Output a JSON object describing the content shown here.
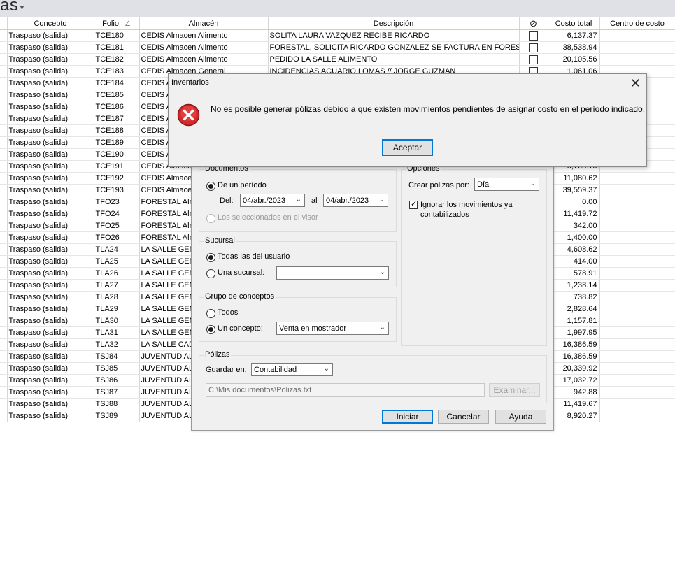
{
  "app": {
    "title_fragment": "as"
  },
  "grid": {
    "columns": [
      "",
      "Concepto",
      "Folio",
      "Almacén",
      "Descripción",
      "",
      "Costo total",
      "Centro de costo"
    ],
    "rows": [
      {
        "concepto": "Traspaso (salida)",
        "folio": "TCE180",
        "almacen": "CEDIS Almacen Alimento",
        "descripcion": "SOLITA LAURA VAZQUEZ  RECIBE RICARDO",
        "costo": "6,137.37"
      },
      {
        "concepto": "Traspaso (salida)",
        "folio": "TCE181",
        "almacen": "CEDIS Almacen Alimento",
        "descripcion": "FORESTAL, SOLICITA RICARDO GONZALEZ SE FACTURA EN FORESTAL EN",
        "costo": "38,538.94"
      },
      {
        "concepto": "Traspaso (salida)",
        "folio": "TCE182",
        "almacen": "CEDIS Almacen Alimento",
        "descripcion": "PEDIDO LA SALLE ALIMENTO",
        "costo": "20,105.56"
      },
      {
        "concepto": "Traspaso (salida)",
        "folio": "TCE183",
        "almacen": "CEDIS Almacen General",
        "descripcion": "INCIDENCIAS ACUARIO LOMAS  // JORGE GUZMAN",
        "costo": "1,061.06"
      },
      {
        "concepto": "Traspaso (salida)",
        "folio": "TCE184",
        "almacen": "CEDIS A",
        "descripcion": "",
        "costo": ""
      },
      {
        "concepto": "Traspaso (salida)",
        "folio": "TCE185",
        "almacen": "CEDIS A",
        "descripcion": "",
        "costo": ""
      },
      {
        "concepto": "Traspaso (salida)",
        "folio": "TCE186",
        "almacen": "CEDIS A",
        "descripcion": "",
        "costo": ""
      },
      {
        "concepto": "Traspaso (salida)",
        "folio": "TCE187",
        "almacen": "CEDIS A",
        "descripcion": "",
        "costo": ""
      },
      {
        "concepto": "Traspaso (salida)",
        "folio": "TCE188",
        "almacen": "CEDIS A",
        "descripcion": "",
        "costo": ""
      },
      {
        "concepto": "Traspaso (salida)",
        "folio": "TCE189",
        "almacen": "CEDIS A",
        "descripcion": "",
        "costo": ""
      },
      {
        "concepto": "Traspaso (salida)",
        "folio": "TCE190",
        "almacen": "CEDIS A",
        "descripcion": "",
        "costo": ""
      },
      {
        "concepto": "Traspaso (salida)",
        "folio": "TCE191",
        "almacen": "CEDIS Almacen",
        "descripcion": "",
        "costo": "6,768.10"
      },
      {
        "concepto": "Traspaso (salida)",
        "folio": "TCE192",
        "almacen": "CEDIS Almacen",
        "descripcion": "",
        "costo": "11,080.62"
      },
      {
        "concepto": "Traspaso (salida)",
        "folio": "TCE193",
        "almacen": "CEDIS Almacen",
        "descripcion": "",
        "costo": "39,559.37"
      },
      {
        "concepto": "Traspaso (salida)",
        "folio": "TFO23",
        "almacen": "FORESTAL Alma",
        "descripcion": "",
        "costo": "0.00"
      },
      {
        "concepto": "Traspaso (salida)",
        "folio": "TFO24",
        "almacen": "FORESTAL Alma",
        "descripcion": "",
        "costo": "11,419.72"
      },
      {
        "concepto": "Traspaso (salida)",
        "folio": "TFO25",
        "almacen": "FORESTAL Alma",
        "descripcion": "",
        "costo": "342.00"
      },
      {
        "concepto": "Traspaso (salida)",
        "folio": "TFO26",
        "almacen": "FORESTAL Alma",
        "descripcion": "",
        "costo": "1,400.00"
      },
      {
        "concepto": "Traspaso (salida)",
        "folio": "TLA24",
        "almacen": "LA SALLE GENE",
        "descripcion": "",
        "costo": "4,608.62"
      },
      {
        "concepto": "Traspaso (salida)",
        "folio": "TLA25",
        "almacen": "LA SALLE GENE",
        "descripcion": "",
        "costo": "414.00"
      },
      {
        "concepto": "Traspaso (salida)",
        "folio": "TLA26",
        "almacen": "LA SALLE GENE",
        "descripcion": "",
        "costo": "578.91"
      },
      {
        "concepto": "Traspaso (salida)",
        "folio": "TLA27",
        "almacen": "LA SALLE GENE",
        "descripcion": "",
        "costo": "1,238.14"
      },
      {
        "concepto": "Traspaso (salida)",
        "folio": "TLA28",
        "almacen": "LA SALLE GENE",
        "descripcion": "",
        "costo": "738.82"
      },
      {
        "concepto": "Traspaso (salida)",
        "folio": "TLA29",
        "almacen": "LA SALLE GENE",
        "descripcion": "",
        "costo": "2,828.64"
      },
      {
        "concepto": "Traspaso (salida)",
        "folio": "TLA30",
        "almacen": "LA SALLE GENE",
        "descripcion": "",
        "costo": "1,157.81"
      },
      {
        "concepto": "Traspaso (salida)",
        "folio": "TLA31",
        "almacen": "LA SALLE GENE",
        "descripcion": "",
        "costo": "1,997.95"
      },
      {
        "concepto": "Traspaso (salida)",
        "folio": "TLA32",
        "almacen": "LA SALLE CADU",
        "descripcion": "",
        "costo": "16,386.59"
      },
      {
        "concepto": "Traspaso (salida)",
        "folio": "TSJ84",
        "almacen": "JUVENTUD ALIN",
        "descripcion": "",
        "costo": "16,386.59"
      },
      {
        "concepto": "Traspaso (salida)",
        "folio": "TSJ85",
        "almacen": "JUVENTUD ALIN",
        "descripcion": "",
        "costo": "20,339.92"
      },
      {
        "concepto": "Traspaso (salida)",
        "folio": "TSJ86",
        "almacen": "JUVENTUD ALIN",
        "descripcion": "",
        "costo": "17,032.72"
      },
      {
        "concepto": "Traspaso (salida)",
        "folio": "TSJ87",
        "almacen": "JUVENTUD ALIN",
        "descripcion": "",
        "costo": "942.88"
      },
      {
        "concepto": "Traspaso (salida)",
        "folio": "TSJ88",
        "almacen": "JUVENTUD ALIN",
        "descripcion": "",
        "costo": "11,419.67"
      },
      {
        "concepto": "Traspaso (salida)",
        "folio": "TSJ89",
        "almacen": "JUVENTUD ALIN",
        "descripcion": "",
        "costo": "8,920.27"
      }
    ]
  },
  "gen_dialog": {
    "documentos": {
      "title": "Documentos",
      "radio_periodo": "De un período",
      "del_label": "Del:",
      "date_from": "04/abr./2023",
      "al_label": "al",
      "date_to": "04/abr./2023",
      "radio_seleccionados": "Los seleccionados en el visor"
    },
    "sucursal": {
      "title": "Sucursal",
      "radio_todas": "Todas las del usuario",
      "radio_una": "Una sucursal:",
      "una_value": ""
    },
    "grupo": {
      "title": "Grupo de conceptos",
      "radio_todos": "Todos",
      "radio_un": "Un concepto:",
      "concepto_value": "Venta en mostrador"
    },
    "opciones": {
      "title": "Opciones",
      "crear_label": "Crear pólizas por:",
      "crear_value": "Día",
      "ignorar_line1": "Ignorar los movimientos ya",
      "ignorar_line2": "contabilizados",
      "ignorar_checked": true
    },
    "polizas": {
      "title": "Pólizas",
      "guardar_label": "Guardar en:",
      "guardar_value": "Contabilidad",
      "path_value": "C:\\Mis documentos\\Polizas.txt",
      "examinar_label": "Examinar..."
    },
    "buttons": {
      "iniciar": "Iniciar",
      "cancelar": "Cancelar",
      "ayuda": "Ayuda"
    }
  },
  "alert": {
    "title": "Inventarios",
    "message": "No es posible generar pólizas debido a que existen movimientos pendientes de asignar costo en el período indicado.",
    "ok_label": "Aceptar",
    "icon": "error-icon"
  },
  "colors": {
    "accent": "#0078d7",
    "error_red": "#d42a2a",
    "dialog_bg": "#f0f0f0",
    "header_strip": "#dfe1e6"
  }
}
